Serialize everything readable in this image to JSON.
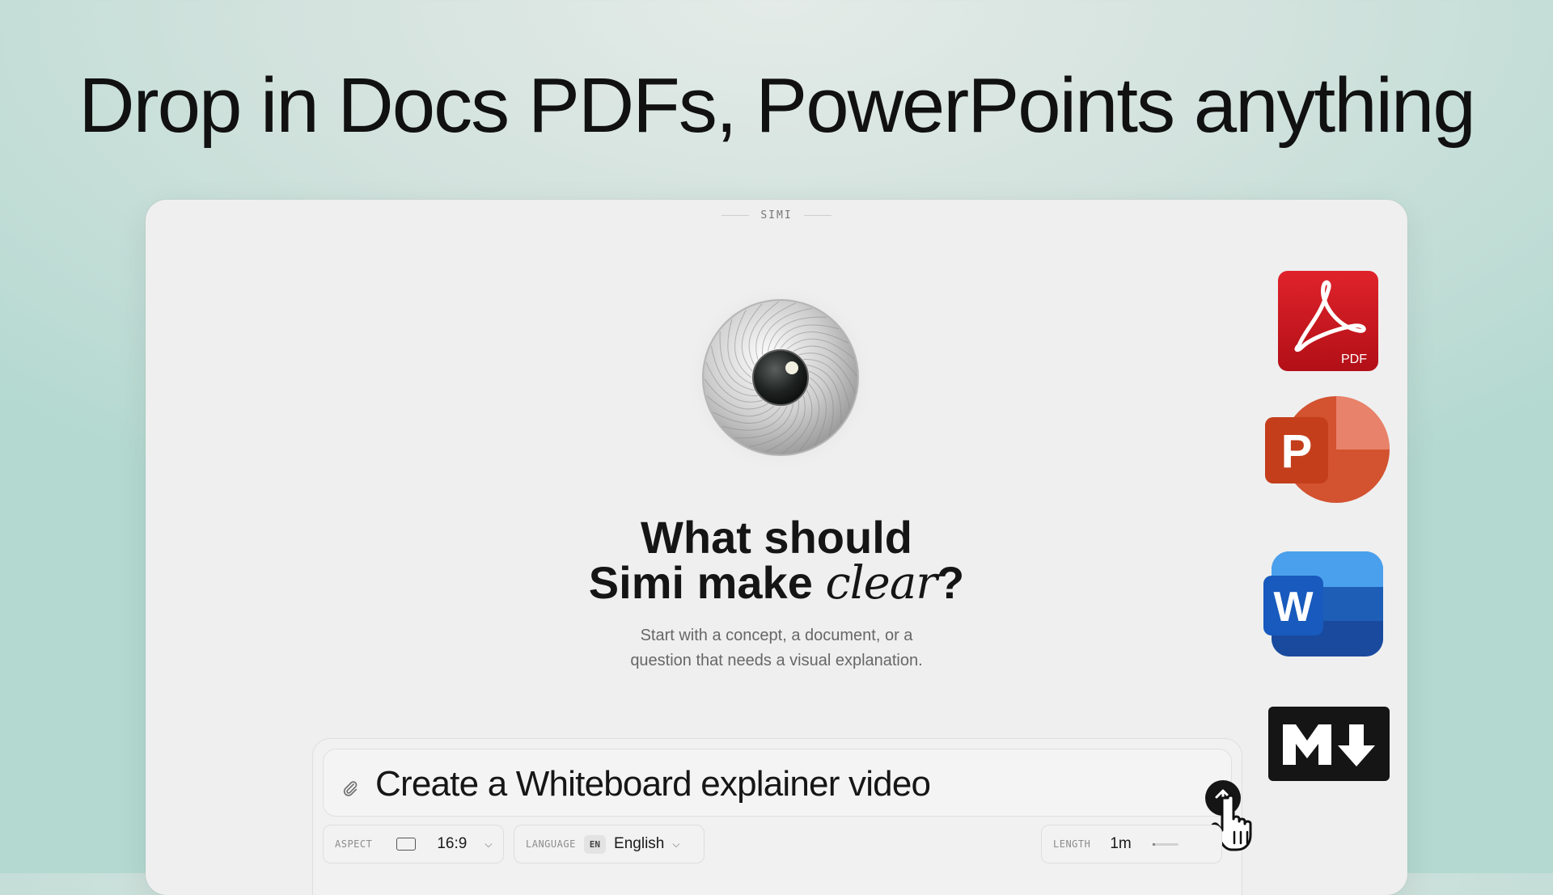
{
  "headline": "Drop in Docs PDFs, PowerPoints anything",
  "app": {
    "brand": "SIMI",
    "hero": {
      "line1": "What should",
      "line2_prefix": "Simi make ",
      "line2_accent": "clear",
      "line2_suffix": "?",
      "subtitle_line1": "Start with a concept, a document, or a",
      "subtitle_line2": "question that needs a visual explanation."
    },
    "composer": {
      "prompt_value": "Create a Whiteboard explainer video",
      "aspect": {
        "label": "ASPECT",
        "value": "16:9"
      },
      "language": {
        "label": "LANGUAGE",
        "code": "EN",
        "value": "English"
      },
      "length": {
        "label": "LENGTH",
        "value": "1m"
      }
    }
  },
  "file_icons": {
    "pdf": {
      "caption": "PDF",
      "color": "#c8151d"
    },
    "powerpoint": {
      "letter": "P",
      "color": "#c43e1c"
    },
    "word": {
      "letter": "W",
      "color": "#1b5ebe"
    },
    "markdown": {
      "color": "#151515"
    }
  }
}
